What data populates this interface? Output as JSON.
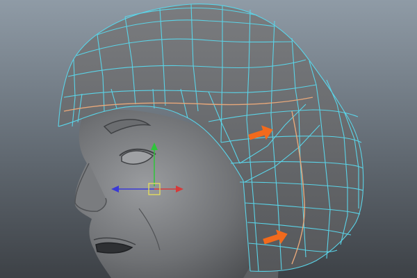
{
  "viewport": {
    "background_top": "#8f9ba6",
    "background_bottom": "#3d4146"
  },
  "model": {
    "surface_color": "#7d7f82",
    "wireframe_color": "#5ad4e8",
    "selected_edge_color": "#e8a87a"
  },
  "annotations": [
    {
      "icon": "right-arrow-icon",
      "color": "#f26a1c"
    },
    {
      "icon": "right-arrow-icon",
      "color": "#f26a1c"
    }
  ],
  "manipulator": {
    "tool": "move-tool",
    "axis_colors": {
      "x": "#d63a3a",
      "y": "#2ec43a",
      "z": "#3a3ad6",
      "center": "#e8e05a"
    }
  }
}
